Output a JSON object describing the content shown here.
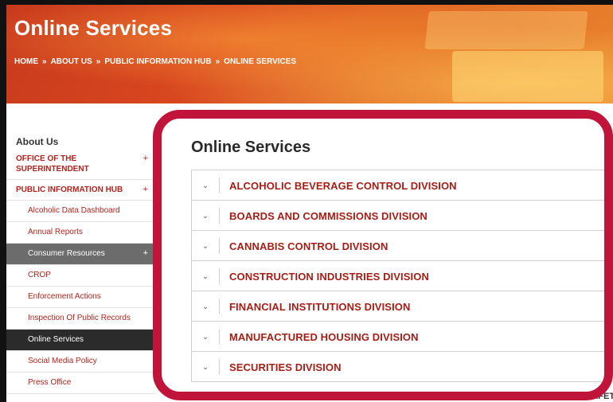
{
  "hero": {
    "title": "Online Services",
    "breadcrumb": [
      "HOME",
      "ABOUT US",
      "PUBLIC INFORMATION HUB",
      "ONLINE SERVICES"
    ],
    "separator": "»"
  },
  "sidebar": {
    "heading": "About Us",
    "top_items": [
      {
        "label": "OFFICE OF THE SUPERINTENDENT",
        "expand": "+"
      },
      {
        "label": "PUBLIC INFORMATION HUB",
        "expand": "+"
      }
    ],
    "sub_items": [
      {
        "label": "Alcoholic Data Dashboard"
      },
      {
        "label": "Annual Reports"
      },
      {
        "label": "Consumer Resources",
        "expand": "+"
      },
      {
        "label": "CROP"
      },
      {
        "label": "Enforcement Actions"
      },
      {
        "label": "Inspection Of Public Records"
      },
      {
        "label": "Online Services",
        "active": true
      },
      {
        "label": "Social Media Policy"
      },
      {
        "label": "Press Office"
      }
    ]
  },
  "main": {
    "title": "Online Services",
    "accordion": [
      "ALCOHOLIC BEVERAGE CONTROL DIVISION",
      "BOARDS AND COMMISSIONS DIVISION",
      "CANNABIS CONTROL DIVISION",
      "CONSTRUCTION INDUSTRIES DIVISION",
      "FINANCIAL INSTITUTIONS DIVISION",
      "MANUFACTURED HOUSING DIVISION",
      "SECURITIES DIVISION"
    ],
    "chevron": "⌄",
    "peek_text": "SAFET"
  },
  "colors": {
    "accent_red": "#a51e16",
    "highlight_ring": "#c1143a",
    "active_item_bg": "#2b2b2b",
    "hover_item_bg": "#6c6c6c"
  }
}
